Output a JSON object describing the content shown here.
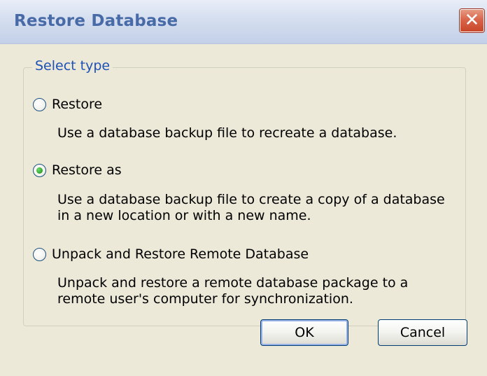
{
  "window": {
    "title": "Restore Database",
    "close_glyph": "✕"
  },
  "group": {
    "legend": "Select type"
  },
  "options": [
    {
      "label": "Restore",
      "checked": false,
      "description": "Use a database backup file to recreate a database."
    },
    {
      "label": "Restore as",
      "checked": true,
      "description_line1": "Use a database backup file to create a copy of a database",
      "description_line2": "in a new location or with a new name."
    },
    {
      "label": "Unpack and Restore Remote Database",
      "checked": false,
      "description_line1": "Unpack and restore a remote database package to a",
      "description_line2": "remote user's computer for synchronization."
    }
  ],
  "buttons": {
    "ok": "OK",
    "cancel": "Cancel"
  },
  "colors": {
    "title_text": "#486aa6",
    "legend_text": "#1e51b5",
    "dialog_background": "#ece9d8",
    "close_button": "#d9654a"
  },
  "icons": {
    "close": "close-icon"
  }
}
